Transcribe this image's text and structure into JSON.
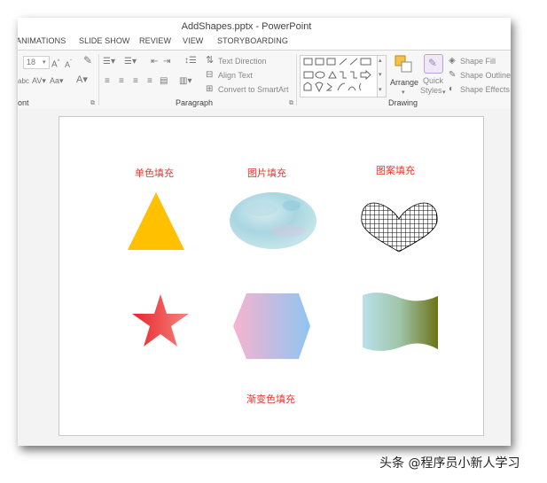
{
  "window": {
    "title": "AddShapes.pptx - PowerPoint"
  },
  "tabs": [
    "ANIMATIONS",
    "SLIDE SHOW",
    "REVIEW",
    "VIEW",
    "STORYBOARDING"
  ],
  "ribbon": {
    "font": {
      "size_value": "18",
      "group_label": "ont"
    },
    "paragraph": {
      "text_direction": "Text Direction",
      "align_text": "Align Text",
      "convert_smartart": "Convert to SmartArt",
      "group_label": "Paragraph"
    },
    "drawing": {
      "arrange": "Arrange",
      "quick_styles_1": "Quick",
      "quick_styles_2": "Styles",
      "shape_fill": "Shape Fill",
      "shape_outline": "Shape Outline",
      "shape_effects": "Shape Effects",
      "group_label": "Drawing"
    }
  },
  "slide": {
    "labels": {
      "solid_fill": "单色填充",
      "picture_fill": "图片填充",
      "pattern_fill": "图案填充",
      "gradient_fill": "渐变色填充"
    },
    "shapes": [
      {
        "name": "triangle",
        "fill": "#ffc000"
      },
      {
        "name": "ellipse",
        "fill": "picture",
        "colors": [
          "#bfe3e9",
          "#9fd2e0",
          "#d8ecef"
        ]
      },
      {
        "name": "heart",
        "fill": "pattern",
        "colors": [
          "#000000",
          "#ffffff"
        ]
      },
      {
        "name": "star",
        "fill": "gradient",
        "colors": [
          "#e8232a",
          "#f4867d"
        ]
      },
      {
        "name": "hexagon",
        "fill": "gradient",
        "colors": [
          "#f7b3cf",
          "#8fc5f2"
        ]
      },
      {
        "name": "wave",
        "fill": "gradient",
        "colors": [
          "#b8e1ea",
          "#6c7316"
        ]
      }
    ]
  },
  "watermark": "头条 @程序员小新人学习"
}
